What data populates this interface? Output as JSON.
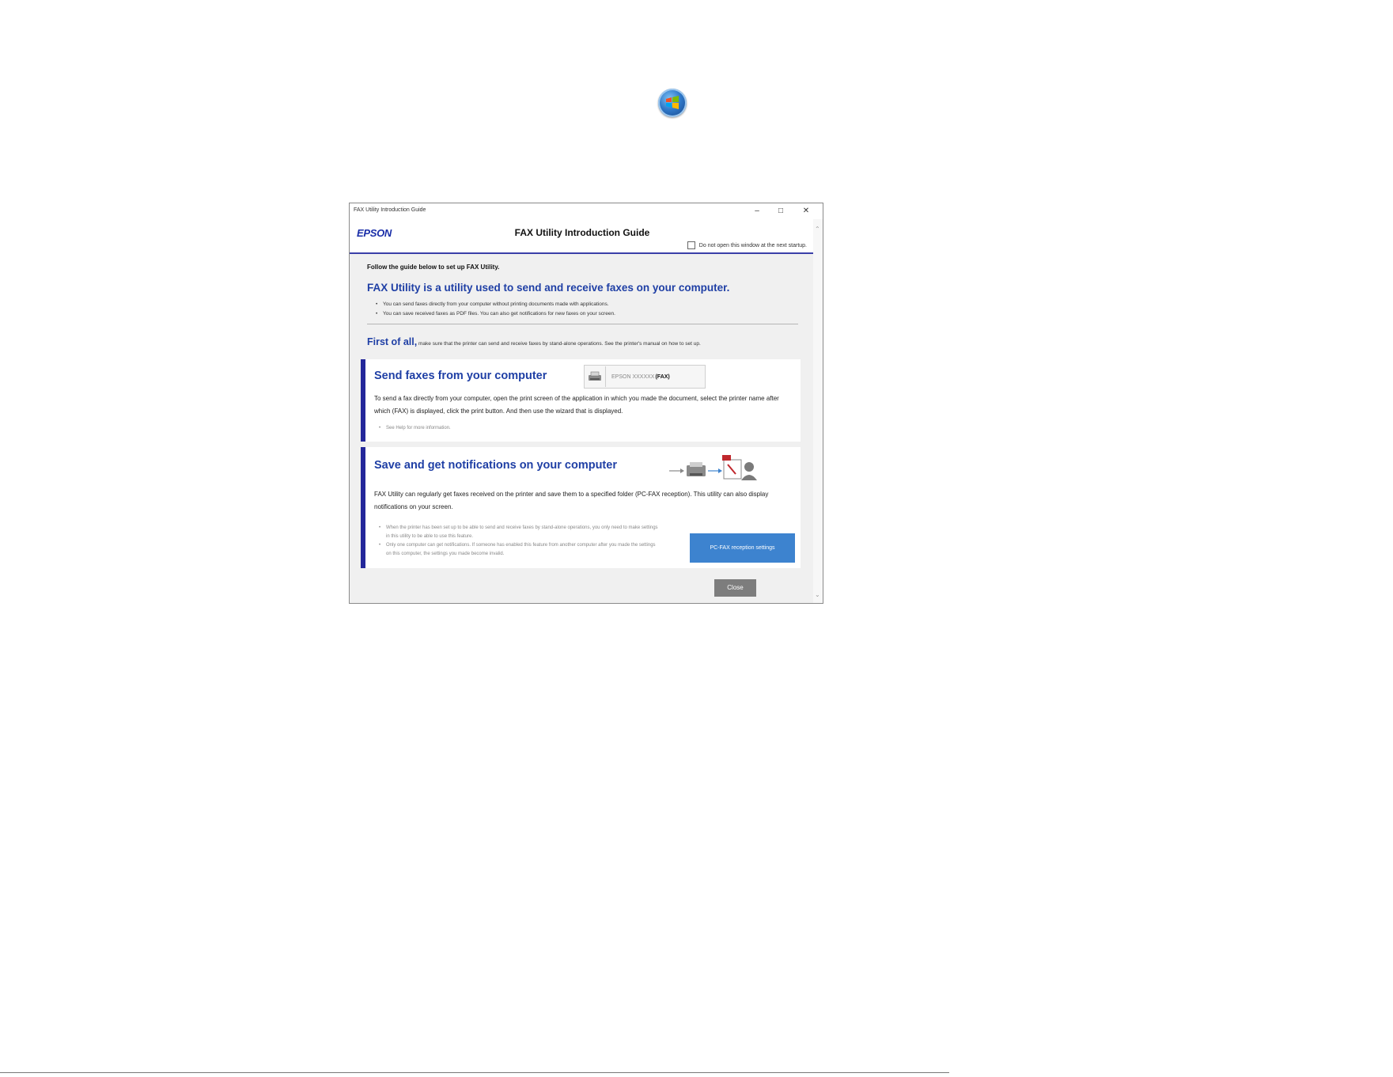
{
  "window": {
    "title": "FAX Utility Introduction Guide",
    "controls": {
      "minimize": "–",
      "maximize": "□",
      "close": "✕"
    }
  },
  "header": {
    "logo": "EPSON",
    "title": "FAX Utility Introduction Guide",
    "startup_checkbox_label": "Do not open this window at the next startup.",
    "startup_checkbox_checked": false
  },
  "intro": {
    "follow": "Follow the guide below to set up FAX Utility.",
    "headline": "FAX Utility is a utility used to send and receive faxes on your computer.",
    "bullets": [
      "You can send faxes directly from your computer without printing documents made with applications.",
      "You can save received faxes as PDF files. You can also get notifications for new faxes on your screen."
    ],
    "first_label": "First of all,",
    "first_text": " make sure that the printer can send and receive faxes by stand-alone operations. See the printer's manual on how to set up."
  },
  "send_section": {
    "title": "Send faxes from your computer",
    "printer_name": "EPSON XXXXXX",
    "printer_suffix": "(FAX)",
    "description": "To send a fax directly from your computer, open the print screen of the application in which you made the document, select the printer name after which (FAX) is displayed, click the print button. And then use the wizard that is displayed.",
    "notes": [
      "See Help for more information."
    ]
  },
  "save_section": {
    "title": "Save and get notifications on your computer",
    "description": "FAX Utility can regularly get faxes received on the printer and save them to a specified folder (PC-FAX reception). This utility can also display notifications on your screen.",
    "notes": [
      "When the printer has been set up to be able to send and receive faxes by stand-alone operations, you only need to make settings in this utility to be able to use this feature.",
      "Only one computer can get notifications. If someone has enabled this feature from another computer after you made the settings on this computer, the settings you made become invalid."
    ],
    "button_label": "PC-FAX reception settings"
  },
  "footer": {
    "close_label": "Close"
  },
  "colors": {
    "accent_blue": "#1f3fa5",
    "panel_bar": "#23279a",
    "button_blue": "#3d83cf",
    "close_gray": "#7d7d7d"
  }
}
